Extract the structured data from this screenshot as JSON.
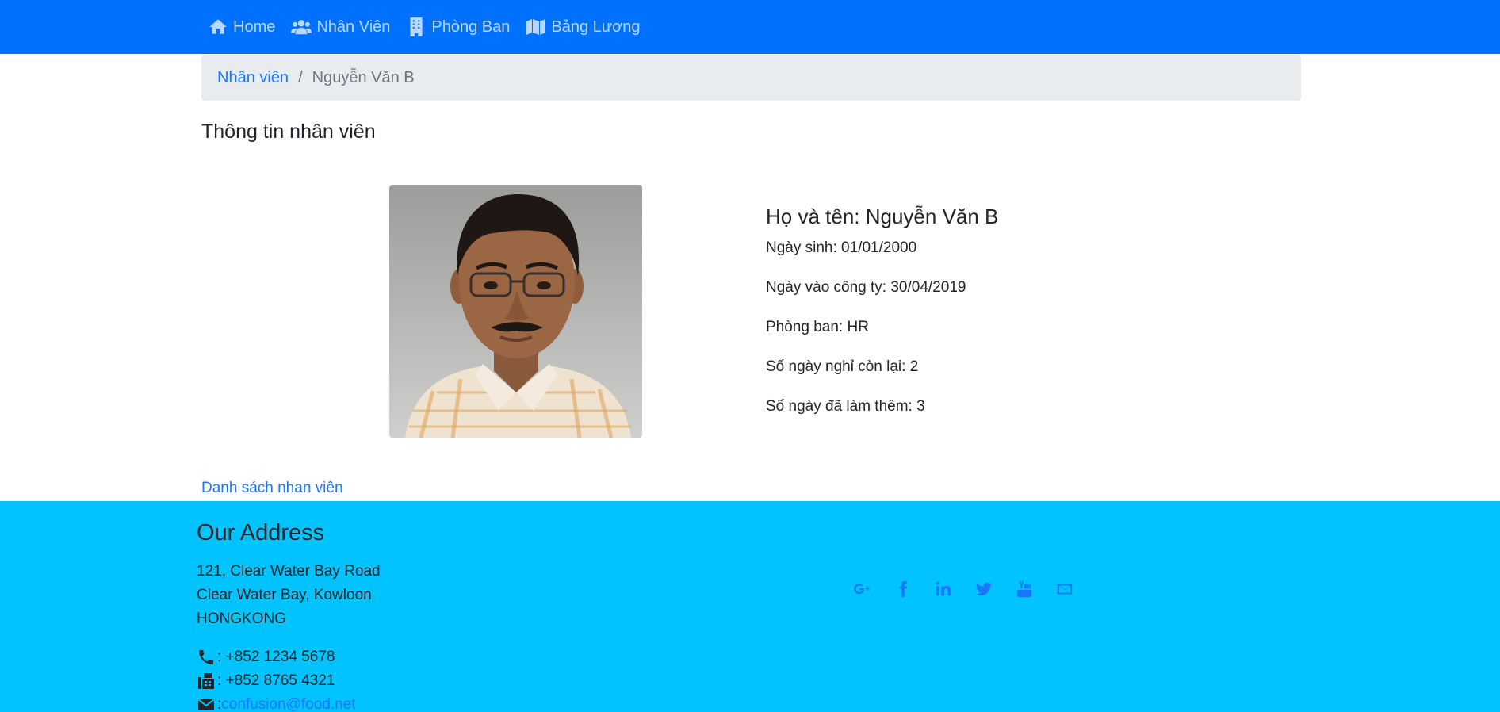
{
  "nav": {
    "items": [
      {
        "label": "Home",
        "icon": "home-icon"
      },
      {
        "label": "Nhân Viên",
        "icon": "users-icon"
      },
      {
        "label": "Phòng Ban",
        "icon": "building-icon"
      },
      {
        "label": "Bảng Lương",
        "icon": "map-icon"
      }
    ],
    "color": "#0070fe"
  },
  "breadcrumb": {
    "parent": "Nhân viên",
    "separator": "/",
    "current": "Nguyễn Văn B"
  },
  "page": {
    "title": "Thông tin nhân viên"
  },
  "employee": {
    "name_line": "Họ và tên: Nguyễn Văn B",
    "dob": "Ngày sinh: 01/01/2000",
    "start_date": "Ngày vào công ty: 30/04/2019",
    "department": "Phòng ban: HR",
    "leave_remaining": "Số ngày nghỉ còn lại: 2",
    "overtime_days": "Số ngày đã làm thêm: 3"
  },
  "list_link": "Danh sách nhan viên",
  "footer": {
    "heading": "Our Address",
    "address": [
      "121, Clear Water Bay Road",
      "Clear Water Bay, Kowloon",
      "HONGKONG"
    ],
    "phone": ": +852 1234 5678",
    "fax": ": +852 8765 4321",
    "email_prefix": ":",
    "email": "confusion@food.net",
    "social_icons": [
      "google-plus-icon",
      "facebook-icon",
      "linkedin-icon",
      "twitter-icon",
      "youtube-icon",
      "envelope-icon"
    ],
    "color": "#00c3ff"
  }
}
